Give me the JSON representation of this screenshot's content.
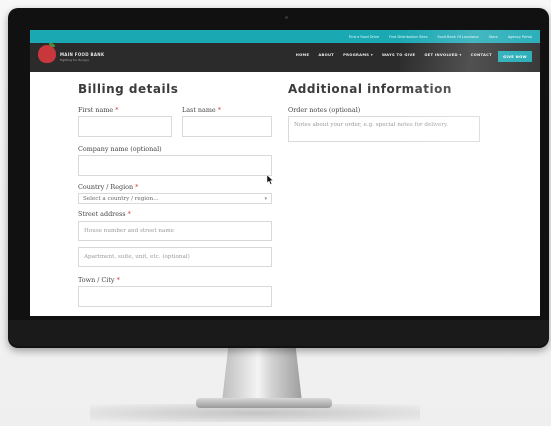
{
  "topbar": {
    "links": [
      "Find a Food Drive",
      "Find Distribution Sites",
      "Food Bank Of Louisiana",
      "Store",
      "Agency Portal"
    ]
  },
  "header": {
    "logo_title": "MAIN FOOD BANK",
    "logo_tagline": "Fighting for Hungry",
    "nav": [
      "HOME",
      "ABOUT",
      "PROGRAMS ▾",
      "WAYS TO GIVE",
      "GET INVOLVED ▾",
      "CONTACT"
    ],
    "give_button": "GIVE NOW"
  },
  "billing": {
    "title": "Billing details",
    "first_name_label": "First name",
    "last_name_label": "Last name",
    "company_label": "Company name (optional)",
    "country_label": "Country / Region",
    "country_value": "Select a country / region…",
    "street_label": "Street address",
    "street1_placeholder": "House number and street name",
    "street2_placeholder": "Apartment, suite, unit, etc. (optional)",
    "town_label": "Town / City",
    "required_mark": "*"
  },
  "additional": {
    "title": "Additional information",
    "order_notes_label": "Order notes (optional)",
    "order_notes_placeholder": "Notes about your order, e.g. special notes for delivery."
  },
  "colors": {
    "accent": "#1aa8b3",
    "navbar": "#2b2b2b",
    "brand_red": "#c8373c",
    "required": "#c8373c"
  },
  "icons": {
    "logo": "apple-logo-icon",
    "cursor": "mouse-pointer-icon",
    "select_caret": "chevron-down-icon"
  }
}
